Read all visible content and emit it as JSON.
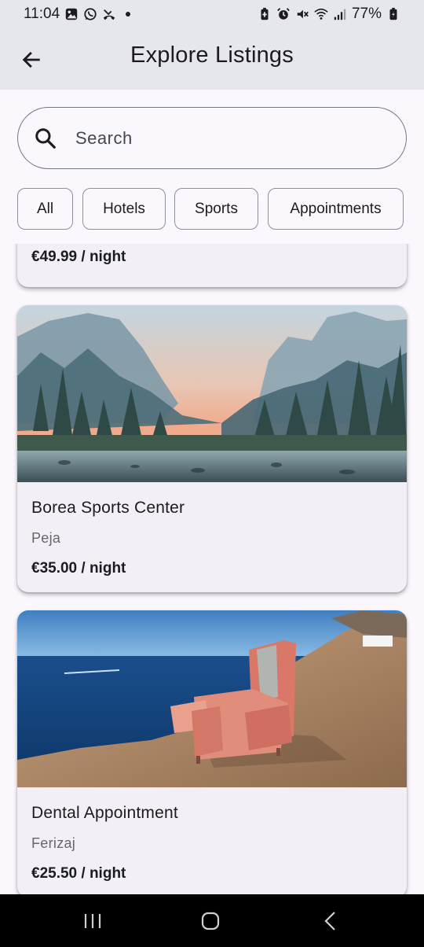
{
  "status_bar": {
    "time": "11:04",
    "battery": "77%",
    "left_icons": [
      "image-icon",
      "whatsapp-icon",
      "missed-call-icon"
    ],
    "right_icons": [
      "battery-saver-icon",
      "alarm-icon",
      "mute-icon",
      "wifi-icon",
      "signal-icon",
      "battery-icon"
    ]
  },
  "app_bar": {
    "title": "Explore Listings",
    "back_icon": "arrow-left-icon"
  },
  "search": {
    "placeholder": "Search",
    "value": "",
    "icon": "search-icon"
  },
  "filters": [
    {
      "label": "All"
    },
    {
      "label": "Hotels"
    },
    {
      "label": "Sports"
    },
    {
      "label": "Appointments"
    }
  ],
  "listings": [
    {
      "title": "",
      "location": "",
      "price": "€49.99 / night"
    },
    {
      "title": "Borea Sports Center",
      "location": "Peja",
      "price": "€35.00 / night",
      "image": "mountain-valley-river"
    },
    {
      "title": "Dental Appointment",
      "location": "Ferizaj",
      "price": "€25.50 / night",
      "image": "armchair-on-sea-cliff"
    }
  ],
  "nav_bar": {
    "icons": [
      "recent-apps-icon",
      "home-icon",
      "back-icon"
    ]
  },
  "colors": {
    "app_bar_bg": "#e6e6ed",
    "page_bg": "#fbf8fd",
    "card_bg": "#f2eff6",
    "outline": "#74777f"
  }
}
